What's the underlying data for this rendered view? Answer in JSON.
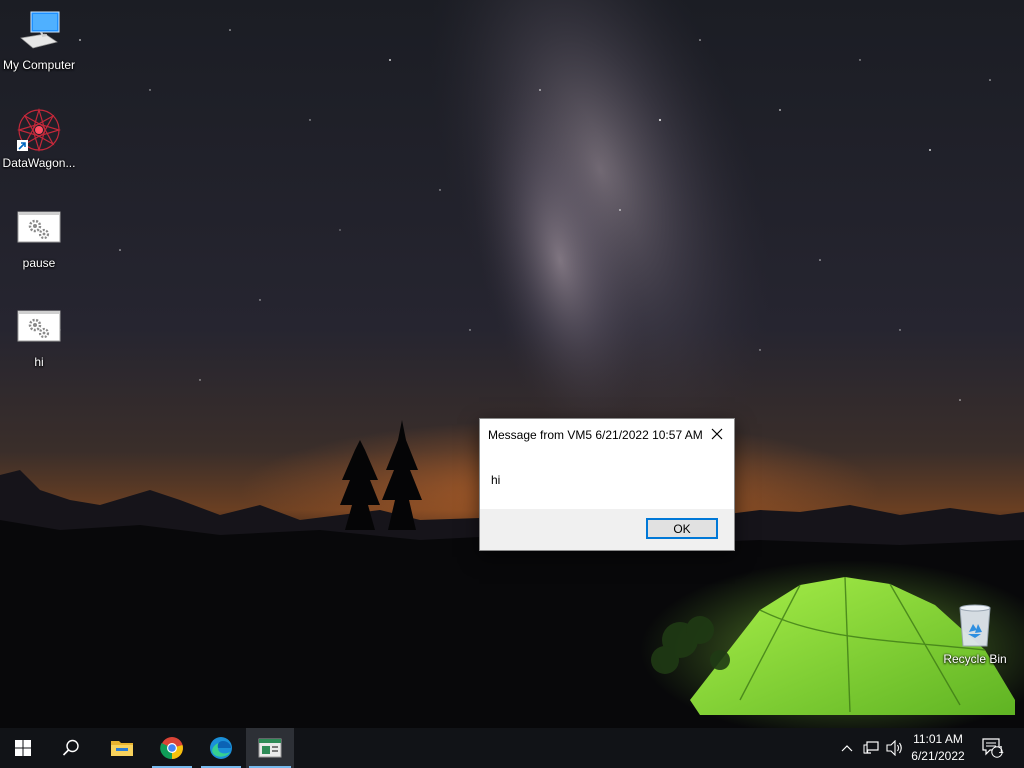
{
  "desktop": {
    "icons": [
      {
        "label": "My Computer",
        "icon": "monitor-icon"
      },
      {
        "label": "DataWagon...",
        "icon": "datawagon-shortcut-icon"
      },
      {
        "label": "pause",
        "icon": "batch-file-gears-icon"
      },
      {
        "label": "hi",
        "icon": "batch-file-gears-icon"
      },
      {
        "label": "Recycle Bin",
        "icon": "recycle-bin-icon"
      }
    ]
  },
  "dialog": {
    "title": "Message from VM5 6/21/2022 10:57 AM",
    "message": "hi",
    "ok_label": "OK",
    "close_icon": "close-icon"
  },
  "taskbar": {
    "items": [
      {
        "name": "start",
        "icon": "windows-start-icon"
      },
      {
        "name": "search",
        "icon": "search-icon"
      },
      {
        "name": "file-explorer",
        "icon": "folder-icon"
      },
      {
        "name": "chrome",
        "icon": "chrome-icon"
      },
      {
        "name": "edge",
        "icon": "edge-icon"
      },
      {
        "name": "message-window",
        "icon": "window-app-icon"
      }
    ],
    "tray": {
      "time": "11:01 AM",
      "date": "6/21/2022",
      "notification_count": "1"
    }
  },
  "colors": {
    "accent": "#0078d7",
    "taskbar_indicator": "#76b9ed",
    "tent": "#7fd63a"
  }
}
